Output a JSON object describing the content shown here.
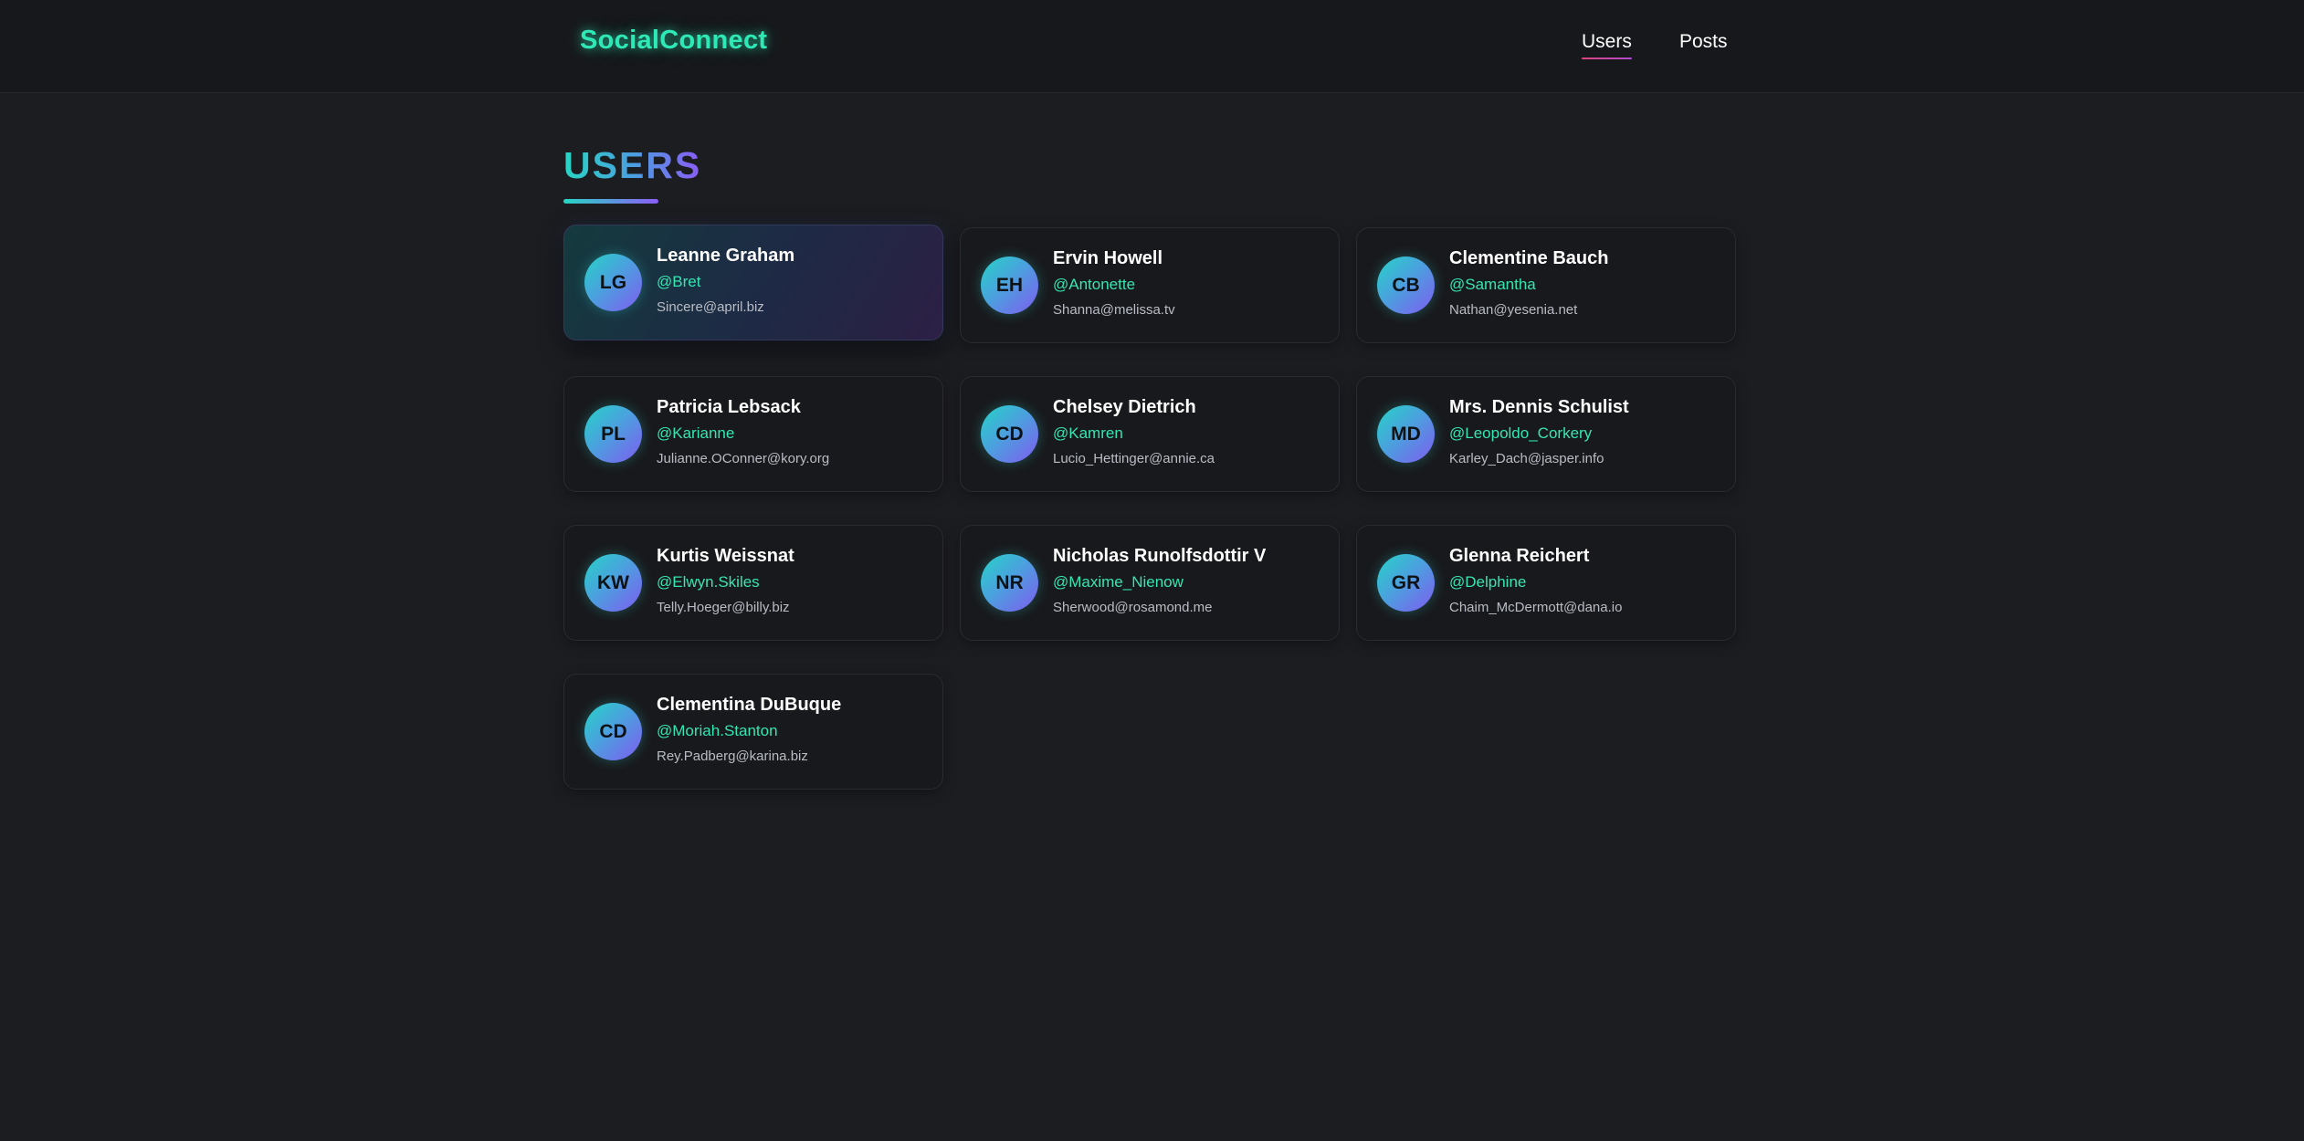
{
  "nav": {
    "brand": "SocialConnect",
    "links": [
      {
        "label": "Users",
        "active": true
      },
      {
        "label": "Posts",
        "active": false
      }
    ]
  },
  "page": {
    "title": "USERS"
  },
  "colors": {
    "accent": "#2ee8b6",
    "background": "#1c1d21",
    "card": "#18191c",
    "gradient_start": "#27d6c3",
    "gradient_end": "#8b5cf6"
  },
  "users": [
    {
      "initials": "LG",
      "name": "Leanne Graham",
      "username": "@Bret",
      "email": "Sincere@april.biz",
      "hovered": true
    },
    {
      "initials": "EH",
      "name": "Ervin Howell",
      "username": "@Antonette",
      "email": "Shanna@melissa.tv"
    },
    {
      "initials": "CB",
      "name": "Clementine Bauch",
      "username": "@Samantha",
      "email": "Nathan@yesenia.net"
    },
    {
      "initials": "PL",
      "name": "Patricia Lebsack",
      "username": "@Karianne",
      "email": "Julianne.OConner@kory.org"
    },
    {
      "initials": "CD",
      "name": "Chelsey Dietrich",
      "username": "@Kamren",
      "email": "Lucio_Hettinger@annie.ca"
    },
    {
      "initials": "MD",
      "name": "Mrs. Dennis Schulist",
      "username": "@Leopoldo_Corkery",
      "email": "Karley_Dach@jasper.info"
    },
    {
      "initials": "KW",
      "name": "Kurtis Weissnat",
      "username": "@Elwyn.Skiles",
      "email": "Telly.Hoeger@billy.biz"
    },
    {
      "initials": "NR",
      "name": "Nicholas Runolfsdottir V",
      "username": "@Maxime_Nienow",
      "email": "Sherwood@rosamond.me"
    },
    {
      "initials": "GR",
      "name": "Glenna Reichert",
      "username": "@Delphine",
      "email": "Chaim_McDermott@dana.io"
    },
    {
      "initials": "CD",
      "name": "Clementina DuBuque",
      "username": "@Moriah.Stanton",
      "email": "Rey.Padberg@karina.biz"
    }
  ]
}
